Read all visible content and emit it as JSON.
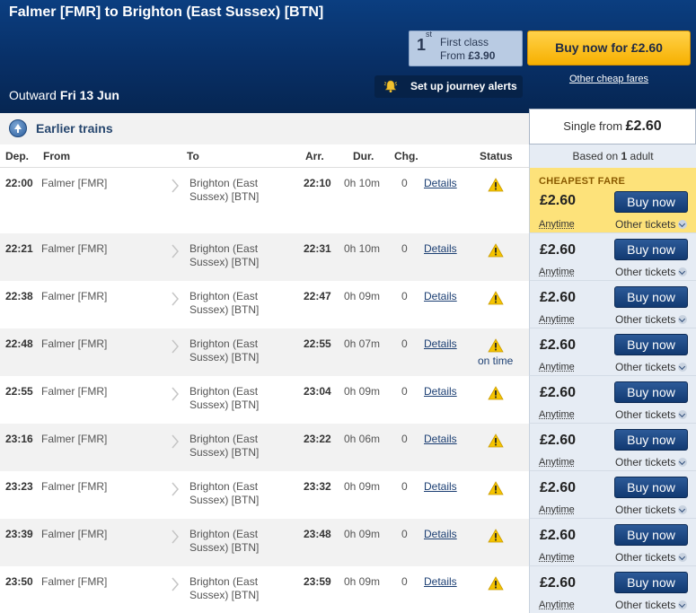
{
  "header": {
    "route": "Falmer [FMR] to Brighton (East Sussex) [BTN]",
    "outward_label": "Outward",
    "outward_date": "Fri 13 Jun",
    "first_class": {
      "badge": "1",
      "badge_sup": "st",
      "label": "First class",
      "from_label": "From",
      "from_price": "£3.90"
    },
    "buy_now_label": "Buy now for £2.60",
    "other_cheap_label": "Other cheap fares",
    "alerts_label": "Set up journey alerts"
  },
  "earlier_label": "Earlier trains",
  "single_from": {
    "label": "Single from",
    "price": "£2.60"
  },
  "based_on": {
    "prefix": "Based on",
    "count": "1",
    "suffix": "adult"
  },
  "columns": {
    "dep": "Dep.",
    "from": "From",
    "to": "To",
    "arr": "Arr.",
    "dur": "Dur.",
    "chg": "Chg.",
    "status": "Status"
  },
  "fare_labels": {
    "cheapest": "CHEAPEST FARE",
    "ticket_type": "Anytime",
    "buy": "Buy now",
    "other": "Other tickets"
  },
  "colors": {
    "header_blue": "#0b3e80",
    "buy_orange": "#f7b000",
    "cheapest_yellow": "#fde27a",
    "fare_panel": "#e6ecf4"
  },
  "trains": [
    {
      "dep": "22:00",
      "from": "Falmer [FMR]",
      "to": "Brighton (East Sussex) [BTN]",
      "arr": "22:10",
      "dur": "0h 10m",
      "chg": "0",
      "details": "Details",
      "status": "",
      "price": "£2.60",
      "cheapest": true
    },
    {
      "dep": "22:21",
      "from": "Falmer [FMR]",
      "to": "Brighton (East Sussex) [BTN]",
      "arr": "22:31",
      "dur": "0h 10m",
      "chg": "0",
      "details": "Details",
      "status": "",
      "price": "£2.60",
      "cheapest": false
    },
    {
      "dep": "22:38",
      "from": "Falmer [FMR]",
      "to": "Brighton (East Sussex) [BTN]",
      "arr": "22:47",
      "dur": "0h 09m",
      "chg": "0",
      "details": "Details",
      "status": "",
      "price": "£2.60",
      "cheapest": false
    },
    {
      "dep": "22:48",
      "from": "Falmer [FMR]",
      "to": "Brighton (East Sussex) [BTN]",
      "arr": "22:55",
      "dur": "0h 07m",
      "chg": "0",
      "details": "Details",
      "status": "on time",
      "price": "£2.60",
      "cheapest": false
    },
    {
      "dep": "22:55",
      "from": "Falmer [FMR]",
      "to": "Brighton (East Sussex) [BTN]",
      "arr": "23:04",
      "dur": "0h 09m",
      "chg": "0",
      "details": "Details",
      "status": "",
      "price": "£2.60",
      "cheapest": false
    },
    {
      "dep": "23:16",
      "from": "Falmer [FMR]",
      "to": "Brighton (East Sussex) [BTN]",
      "arr": "23:22",
      "dur": "0h 06m",
      "chg": "0",
      "details": "Details",
      "status": "",
      "price": "£2.60",
      "cheapest": false
    },
    {
      "dep": "23:23",
      "from": "Falmer [FMR]",
      "to": "Brighton (East Sussex) [BTN]",
      "arr": "23:32",
      "dur": "0h 09m",
      "chg": "0",
      "details": "Details",
      "status": "",
      "price": "£2.60",
      "cheapest": false
    },
    {
      "dep": "23:39",
      "from": "Falmer [FMR]",
      "to": "Brighton (East Sussex) [BTN]",
      "arr": "23:48",
      "dur": "0h 09m",
      "chg": "0",
      "details": "Details",
      "status": "",
      "price": "£2.60",
      "cheapest": false
    },
    {
      "dep": "23:50",
      "from": "Falmer [FMR]",
      "to": "Brighton (East Sussex) [BTN]",
      "arr": "23:59",
      "dur": "0h 09m",
      "chg": "0",
      "details": "Details",
      "status": "",
      "price": "£2.60",
      "cheapest": false
    }
  ]
}
